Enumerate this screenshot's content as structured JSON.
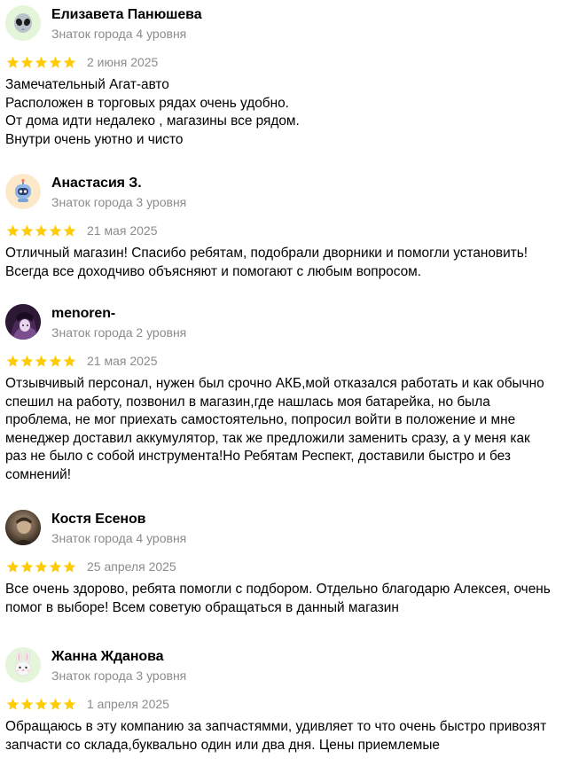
{
  "reviews": [
    {
      "author": "Елизавета Панюшева",
      "level": "Знаток города 4 уровня",
      "rating": 5,
      "date": "2 июня 2025",
      "avatar": "alien-icon",
      "avatar_bg": "#e4f5d9",
      "lines": [
        "Замечательный Агат-авто",
        "Расположен в торговых рядах очень удобно.",
        "От дома идти недалеко , магазины все рядом.",
        "Внутри очень уютно и чисто"
      ]
    },
    {
      "author": "Анастасия З.",
      "level": "Знаток города 3 уровня",
      "rating": 5,
      "date": "21 мая 2025",
      "avatar": "robot-icon",
      "avatar_bg": "#fde9c9",
      "lines": [
        "Отличный магазин! Спасибо ребятам, подобрали дворники и помогли установить!",
        "Всегда все доходчиво объясняют и помогают с любым вопросом."
      ]
    },
    {
      "author": "menoren-",
      "level": "Знаток города 2 уровня",
      "rating": 5,
      "date": "21 мая 2025",
      "avatar": "user-photo-avatar",
      "avatar_bg": "#3a1f3f",
      "lines": [
        "Отзывчивый персонал, нужен был срочно АКБ,мой отказался работать и как обычно",
        "спешил на работу, позвонил в магазин,где нашлась моя батарейка, но была",
        "проблема, не мог приехать самостоятельно, попросил войти в положение и мне",
        "менеджер доставил аккумулятор, так же предложили заменить сразу, а у меня как",
        "раз не было с собой инструмента!Но Ребятам Респект, доставили быстро и без",
        "сомнений!"
      ]
    },
    {
      "author": "Костя Есенов",
      "level": "Знаток города 4 уровня",
      "rating": 5,
      "date": "25 апреля 2025",
      "avatar": "user-photo-avatar",
      "avatar_bg": "#5a4a3a",
      "lines": [
        "Все очень здорово, ребята помогли с подбором. Отдельно благодарю Алексея, очень",
        "помог в выборе! Всем советую обращаться в данный магазин"
      ]
    },
    {
      "author": "Жанна Жданова",
      "level": "Знаток города 3 уровня",
      "rating": 5,
      "date": "1 апреля 2025",
      "avatar": "rabbit-icon",
      "avatar_bg": "#e4f5d9",
      "lines": [
        "Обращаюсь в эту компанию за запчастямми, удивляет то что очень быстро привозят",
        "запчасти со склада,буквально один или два дня. Цены приемлемые"
      ]
    }
  ],
  "colors": {
    "star": "#fc0",
    "muted_text": "#8b8b8b"
  }
}
